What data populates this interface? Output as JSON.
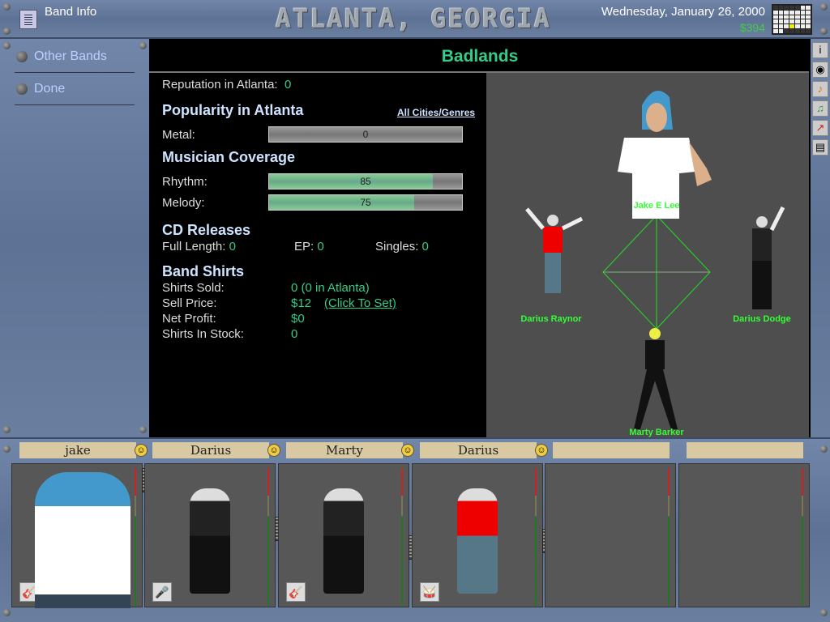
{
  "header": {
    "title": "Band Info",
    "city": "ATLANTA, GEORGIA",
    "date": "Wednesday, January 26, 2000",
    "money": "$394",
    "calendar_icon": "calendar-icon"
  },
  "nav": [
    {
      "label": "Other Bands"
    },
    {
      "label": "Done"
    }
  ],
  "band": {
    "name": "Badlands"
  },
  "info": {
    "reputation_label": "Reputation in Atlanta:",
    "reputation": "0",
    "popularity_heading": "Popularity in Atlanta",
    "all_cities_link": "All Cities/Genres",
    "genres": [
      {
        "label": "Metal:",
        "value": 0
      }
    ],
    "coverage_heading": "Musician Coverage",
    "coverage": [
      {
        "label": "Rhythm:",
        "value": 85
      },
      {
        "label": "Melody:",
        "value": 75
      }
    ],
    "cd_heading": "CD Releases",
    "cd": [
      {
        "label": "Full Length:",
        "value": "0"
      },
      {
        "label": "EP:",
        "value": "0"
      },
      {
        "label": "Singles:",
        "value": "0"
      }
    ],
    "shirts_heading": "Band Shirts",
    "shirts": [
      {
        "label": "Shirts Sold:",
        "value": "0 (0 in Atlanta)"
      },
      {
        "label": "Sell Price:",
        "value": "$12",
        "link": "(Click To Set)"
      },
      {
        "label": "Net Profit:",
        "value": "$0"
      },
      {
        "label": "Shirts In Stock:",
        "value": "0"
      }
    ]
  },
  "chemistry": {
    "members": [
      "Jake E Lee",
      "Darius Raynor",
      "Darius Dodge",
      "Marty Barker"
    ],
    "line_color": "#22dd22"
  },
  "side_icons": [
    "info-icon",
    "cd-icon",
    "music-note-icon",
    "guitar-icon",
    "chart-icon",
    "news-icon"
  ],
  "slots": [
    {
      "name": "jake",
      "instrument": "guitar-icon",
      "fader": 1.0
    },
    {
      "name": "Darius",
      "instrument": "microphone-icon",
      "fader": 0.6
    },
    {
      "name": "Marty",
      "instrument": "bass-icon",
      "fader": 0.45
    },
    {
      "name": "Darius",
      "instrument": "drum-icon",
      "fader": 0.5
    },
    {
      "name": "",
      "instrument": "",
      "fader": null
    },
    {
      "name": "",
      "instrument": "",
      "fader": null
    }
  ]
}
